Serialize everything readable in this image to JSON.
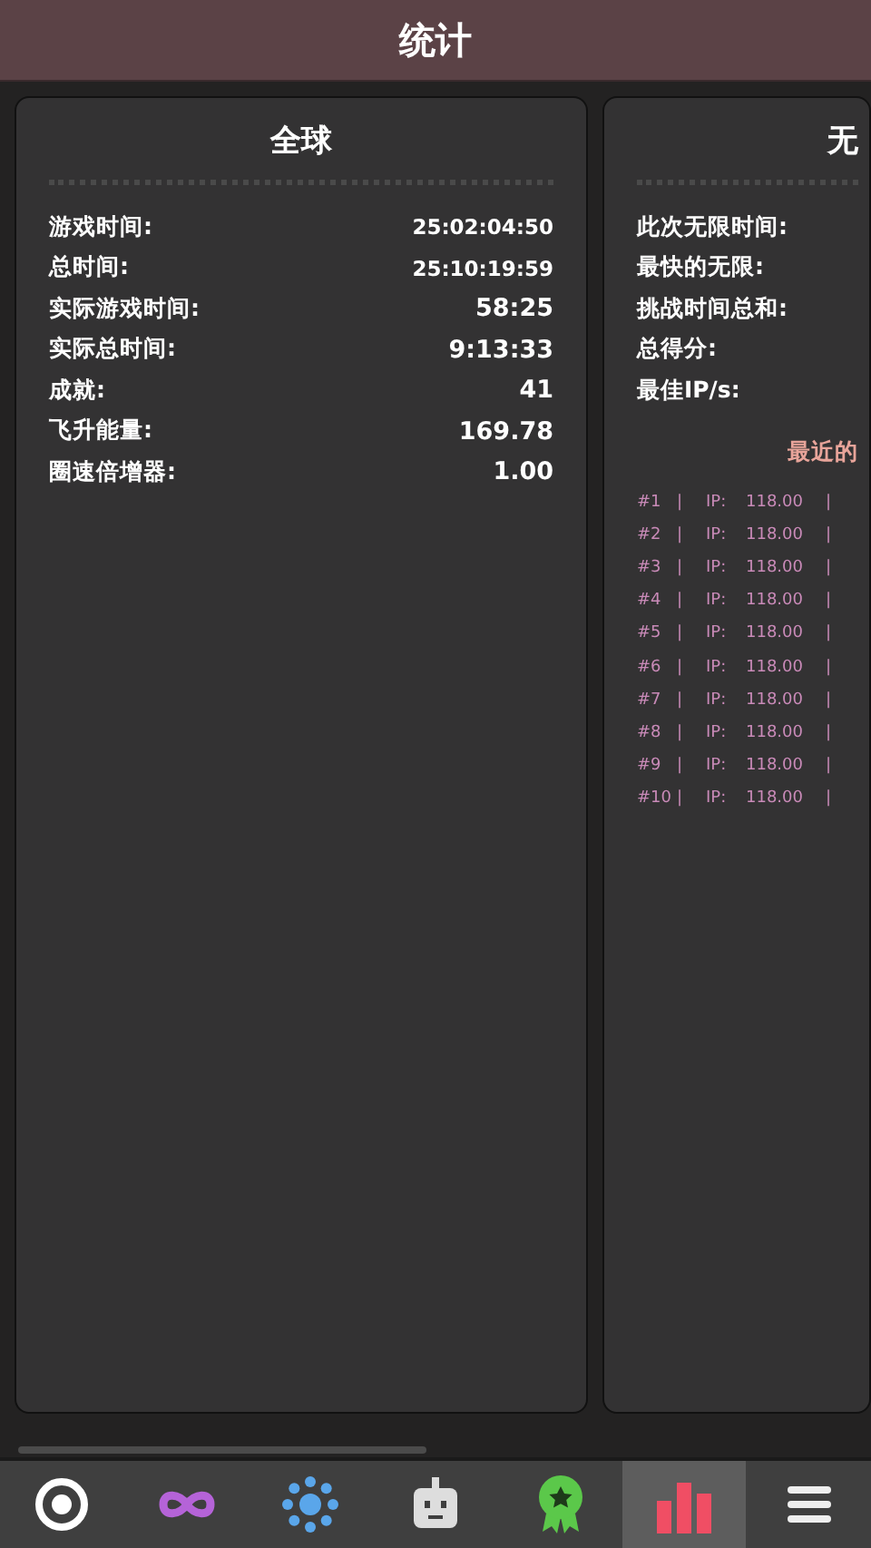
{
  "header": {
    "title": "统计"
  },
  "global_card": {
    "title": "全球",
    "stats": [
      {
        "label": "游戏时间:",
        "value": "25:02:04:50"
      },
      {
        "label": "总时间:",
        "value": "25:10:19:59"
      },
      {
        "label": "实际游戏时间:",
        "value": "58:25"
      },
      {
        "label": "实际总时间:",
        "value": "9:13:33"
      },
      {
        "label": "成就:",
        "value": "41"
      },
      {
        "label": "飞升能量:",
        "value": "169.78"
      },
      {
        "label": "圈速倍增器:",
        "value": "1.00"
      }
    ]
  },
  "infinity_card": {
    "title": "无",
    "stats": [
      {
        "label": "此次无限时间:"
      },
      {
        "label": "最快的无限:"
      },
      {
        "label": "挑战时间总和:"
      },
      {
        "label": "总得分:"
      },
      {
        "label": "最佳IP/s:"
      }
    ],
    "recent_title": "最近的",
    "recent_runs": [
      {
        "rank": "#1",
        "sep": "|",
        "ip_label": "IP:",
        "ip": "118.00",
        "sep_end": "|"
      },
      {
        "rank": "#2",
        "sep": "|",
        "ip_label": "IP:",
        "ip": "118.00",
        "sep_end": "|"
      },
      {
        "rank": "#3",
        "sep": "|",
        "ip_label": "IP:",
        "ip": "118.00",
        "sep_end": "|"
      },
      {
        "rank": "#4",
        "sep": "|",
        "ip_label": "IP:",
        "ip": "118.00",
        "sep_end": "|"
      },
      {
        "rank": "#5",
        "sep": "|",
        "ip_label": "IP:",
        "ip": "118.00",
        "sep_end": "|"
      },
      {
        "rank": "#6",
        "sep": "|",
        "ip_label": "IP:",
        "ip": "118.00",
        "sep_end": "|"
      },
      {
        "rank": "#7",
        "sep": "|",
        "ip_label": "IP:",
        "ip": "118.00",
        "sep_end": "|"
      },
      {
        "rank": "#8",
        "sep": "|",
        "ip_label": "IP:",
        "ip": "118.00",
        "sep_end": "|"
      },
      {
        "rank": "#9",
        "sep": "|",
        "ip_label": "IP:",
        "ip": "118.00",
        "sep_end": "|"
      },
      {
        "rank": "#10",
        "sep": "|",
        "ip_label": "IP:",
        "ip": "118.00",
        "sep_end": "|"
      }
    ]
  },
  "tab_bar": [
    {
      "kind": "ring",
      "selected": false
    },
    {
      "kind": "infinity",
      "selected": false
    },
    {
      "kind": "dots",
      "selected": false
    },
    {
      "kind": "robot",
      "selected": false
    },
    {
      "kind": "medal",
      "selected": false
    },
    {
      "kind": "chart",
      "selected": true
    },
    {
      "kind": "menu",
      "selected": false
    }
  ]
}
